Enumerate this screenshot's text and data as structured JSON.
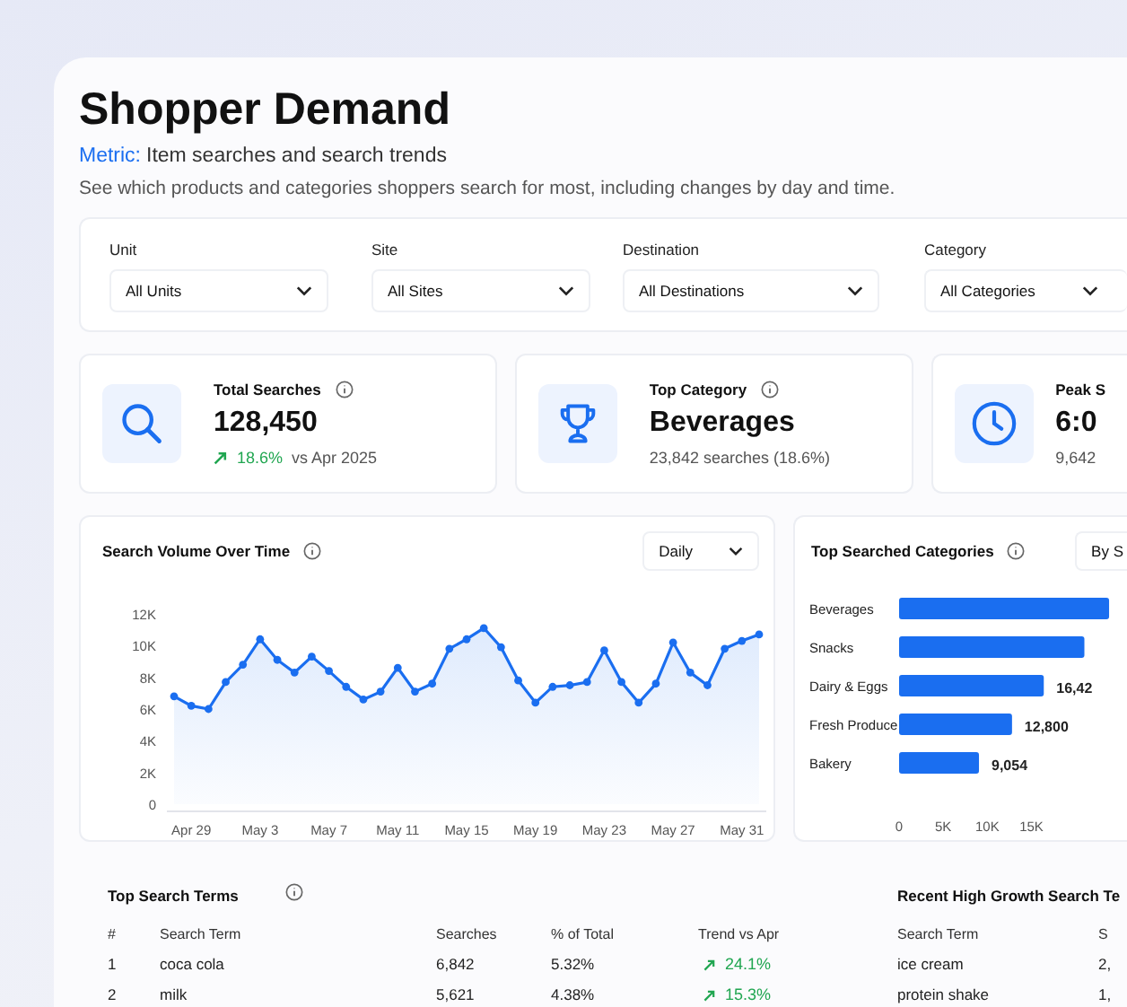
{
  "title": "Shopper Demand",
  "metric": {
    "label": "Metric:",
    "value": "Item searches and search trends"
  },
  "description": "See which products and categories shoppers search for most, including changes by day and time.",
  "filters": [
    {
      "label": "Unit",
      "value": "All Units"
    },
    {
      "label": "Site",
      "value": "All Sites"
    },
    {
      "label": "Destination",
      "value": "All Destinations"
    },
    {
      "label": "Category",
      "value": "All Categories"
    }
  ],
  "kpis": [
    {
      "kind": "search",
      "title": "Total Searches",
      "info": true,
      "value": "128,450",
      "change": "18.6%",
      "note": "vs Apr 2025"
    },
    {
      "kind": "trophy",
      "title": "Top Category",
      "info": true,
      "value": "Beverages",
      "note": "23,842 searches (18.6%)"
    },
    {
      "kind": "clock",
      "title": "Peak S",
      "info": false,
      "value": "6:0",
      "note": "9,642"
    }
  ],
  "volume_chart": {
    "title": "Search Volume Over Time",
    "period": "Daily",
    "chart_data": {
      "type": "area",
      "categories": [
        null,
        "Apr 29",
        null,
        null,
        null,
        "May 3",
        null,
        null,
        null,
        "May 7",
        null,
        null,
        null,
        "May 11",
        null,
        null,
        null,
        "May 15",
        null,
        null,
        null,
        "May 19",
        null,
        null,
        null,
        "May 23",
        null,
        null,
        null,
        "May 27",
        null,
        null,
        null,
        "May 31",
        null
      ],
      "series": [
        {
          "color": "#1a6ef0",
          "values": [
            6800,
            6200,
            6000,
            7700,
            8800,
            10400,
            9100,
            8300,
            9300,
            8400,
            7400,
            6600,
            7100,
            8600,
            7100,
            7600,
            9800,
            10400,
            11100,
            9900,
            7800,
            6400,
            7400,
            7500,
            7700,
            9700,
            7700,
            6400,
            7600,
            10200,
            8300,
            7500,
            9800,
            10300,
            10700
          ]
        }
      ],
      "ylim": [
        0,
        12000
      ],
      "yticks": [
        0,
        {
          "value": 2000,
          "label": "2K"
        },
        {
          "value": 4000,
          "label": "4K"
        },
        {
          "value": 6000,
          "label": "6K"
        },
        {
          "value": 8000,
          "label": "8K"
        },
        {
          "value": 10000,
          "label": "10K"
        },
        {
          "value": 12000,
          "label": "12K"
        }
      ]
    }
  },
  "categories_chart": {
    "title": "Top Searched Categories",
    "sort": "By S",
    "chart_data": {
      "type": "bar",
      "orientation": "horizontal",
      "categories": [
        "Beverages",
        "Snacks",
        "Dairy & Eggs",
        "Fresh Produce",
        "Bakery"
      ],
      "series": [
        {
          "color": "#1a6ef0",
          "values": [
            23800,
            21000,
            16400,
            12800,
            9054
          ]
        }
      ],
      "xlim": [
        0,
        24000
      ],
      "value_labels": [
        null,
        null,
        "16,42",
        "12,800",
        "9,054"
      ],
      "xticks": [
        0,
        {
          "value": 5000,
          "label": "5K"
        },
        {
          "value": 10000,
          "label": "10K"
        },
        {
          "value": 15000,
          "label": "15K"
        }
      ]
    }
  },
  "top_terms": {
    "title": "Top Search Terms",
    "columns": [
      "#",
      "Search Term",
      "Searches",
      "% of Total",
      "Trend vs Apr"
    ],
    "rows": [
      {
        "rank": "1",
        "term": "coca cola",
        "searches": "6,842",
        "share": "5.32%",
        "trend": "24.1%"
      },
      {
        "rank": "2",
        "term": "milk",
        "searches": "5,621",
        "share": "4.38%",
        "trend": "15.3%"
      }
    ]
  },
  "growth_terms": {
    "title": "Recent High Growth Search Te",
    "columns": [
      "Search Term",
      "S"
    ],
    "rows": [
      {
        "term": "ice cream",
        "searches": "2,"
      },
      {
        "term": "protein shake",
        "searches": "1,"
      }
    ]
  }
}
